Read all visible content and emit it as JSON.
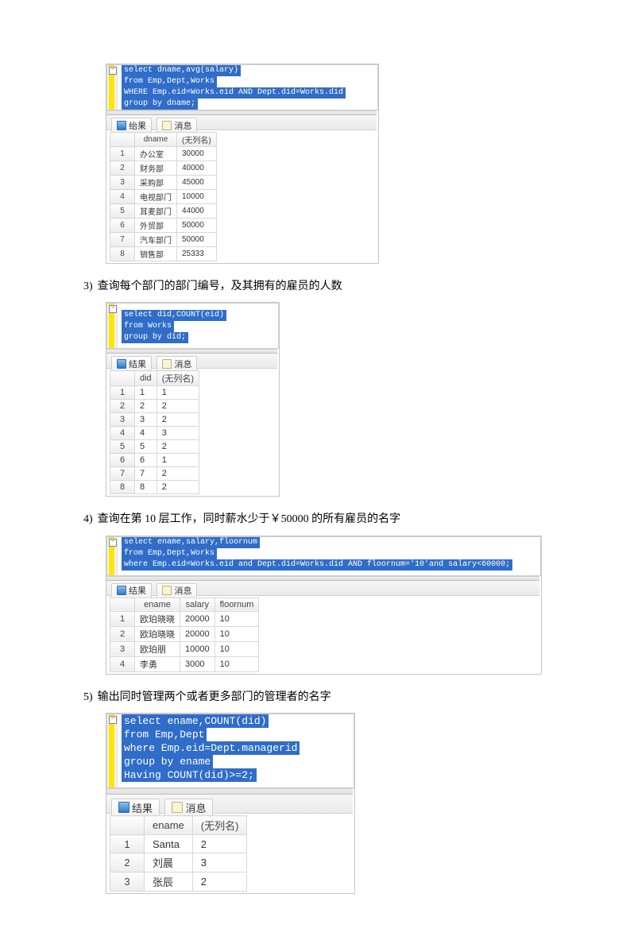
{
  "tabs": {
    "results": "结果",
    "messages": "消息",
    "results_alt": "绐果"
  },
  "grid_nocol": "(无列名)",
  "item1": {
    "sql": [
      "select dname,avg(salary)",
      "from Emp,Dept,Works",
      "WHERE Emp.eid=Works.eid AND Dept.did=Works.did",
      "group by dname;"
    ],
    "cols": [
      "dname",
      "(无列名)"
    ],
    "rows": [
      [
        "办公室",
        "30000"
      ],
      [
        "财务部",
        "40000"
      ],
      [
        "采购部",
        "45000"
      ],
      [
        "电视部门",
        "10000"
      ],
      [
        "耳麦部门",
        "44000"
      ],
      [
        "外贸部",
        "50000"
      ],
      [
        "汽车部门",
        "50000"
      ],
      [
        "销售部",
        "25333"
      ]
    ]
  },
  "item3": {
    "label": "查询每个部门的部门编号，及其拥有的雇员的人数",
    "sql": [
      "select did,COUNT(eid)",
      "from Works",
      "group by did;"
    ],
    "cols": [
      "did",
      "(无列名)"
    ],
    "rows": [
      [
        "1",
        "1"
      ],
      [
        "2",
        "2"
      ],
      [
        "3",
        "2"
      ],
      [
        "4",
        "3"
      ],
      [
        "5",
        "2"
      ],
      [
        "6",
        "1"
      ],
      [
        "7",
        "2"
      ],
      [
        "8",
        "2"
      ]
    ]
  },
  "item4": {
    "label": "查询在第 10 层工作，同时薪水少于￥50000 的所有雇员的名字",
    "sql": [
      "select ename,salary,floornum",
      "from Emp,Dept,Works",
      "where Emp.eid=Works.eid and Dept.did=Works.did AND floornum='10'and salary<60000;"
    ],
    "cols": [
      "ename",
      "salary",
      "floornum"
    ],
    "rows": [
      [
        "欧珀晓晓",
        "20000",
        "10"
      ],
      [
        "欧珀晓晓",
        "20000",
        "10"
      ],
      [
        "欧珀朋",
        "10000",
        "10"
      ],
      [
        "李勇",
        "3000",
        "10"
      ]
    ]
  },
  "item5": {
    "label": "输出同时管理两个或者更多部门的管理者的名字",
    "sql": [
      "select ename,COUNT(did)",
      "from Emp,Dept",
      "where Emp.eid=Dept.managerid",
      " group by ename",
      " Having COUNT(did)>=2;"
    ],
    "cols": [
      "ename",
      "(无列名)"
    ],
    "rows": [
      [
        "Santa",
        "2"
      ],
      [
        "刘晨",
        "3"
      ],
      [
        "张辰",
        "2"
      ]
    ]
  },
  "nums": {
    "n3": "3)",
    "n4": "4)",
    "n5": "5)"
  }
}
